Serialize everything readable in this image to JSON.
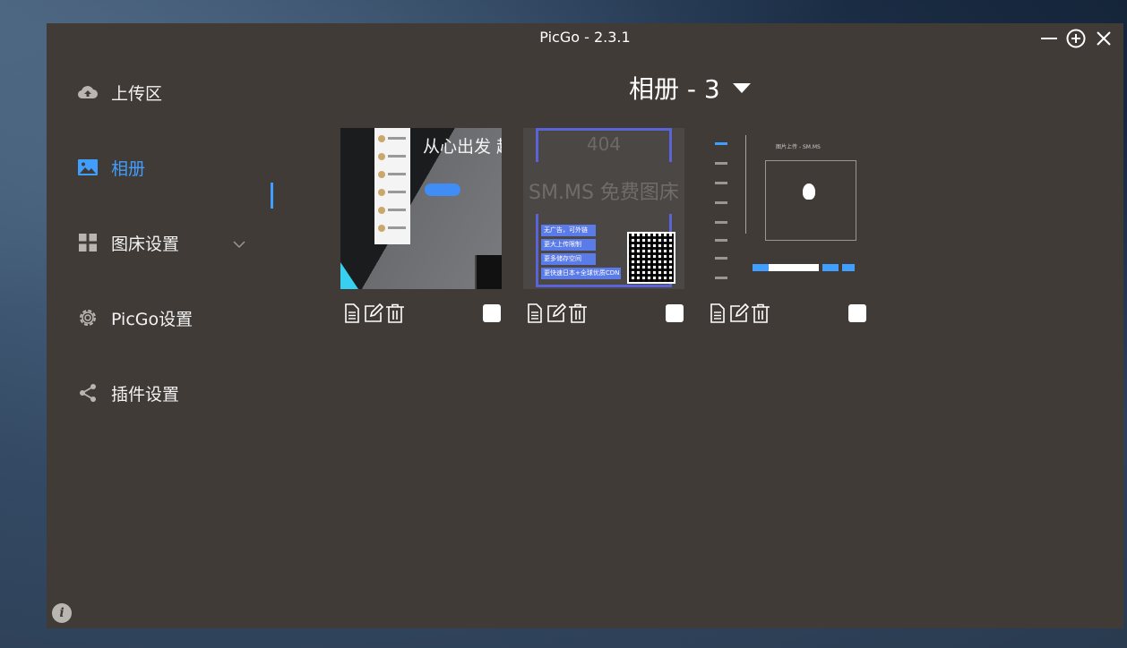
{
  "window": {
    "title": "PicGo - 2.3.1"
  },
  "sidebar": {
    "items": [
      {
        "label": "上传区",
        "icon": "cloud-upload-icon",
        "active": false
      },
      {
        "label": "相册",
        "icon": "image-icon",
        "active": true
      },
      {
        "label": "图床设置",
        "icon": "grid-icon",
        "active": false,
        "expandable": true
      },
      {
        "label": "PicGo设置",
        "icon": "gear-icon",
        "active": false
      },
      {
        "label": "插件设置",
        "icon": "share-icon",
        "active": false
      }
    ]
  },
  "gallery": {
    "title": "相册 - 3",
    "images": [
      {
        "thumb_text": "从心出发 趣无止境",
        "checked": false
      },
      {
        "thumb_404": "404",
        "thumb_title": "SM.MS 免费图床",
        "thumb_tags": [
          "无广告，可外链",
          "更大上传限制",
          "更多储存空间",
          "更快速日本+全球优质CDN"
        ],
        "checked": false
      },
      {
        "thumb_heading": "图片上传 - SM.MS",
        "checked": false
      }
    ],
    "actions": [
      "copy-link-icon",
      "edit-icon",
      "delete-icon"
    ]
  },
  "colors": {
    "accent": "#409eff",
    "window_bg": "#403b37"
  }
}
